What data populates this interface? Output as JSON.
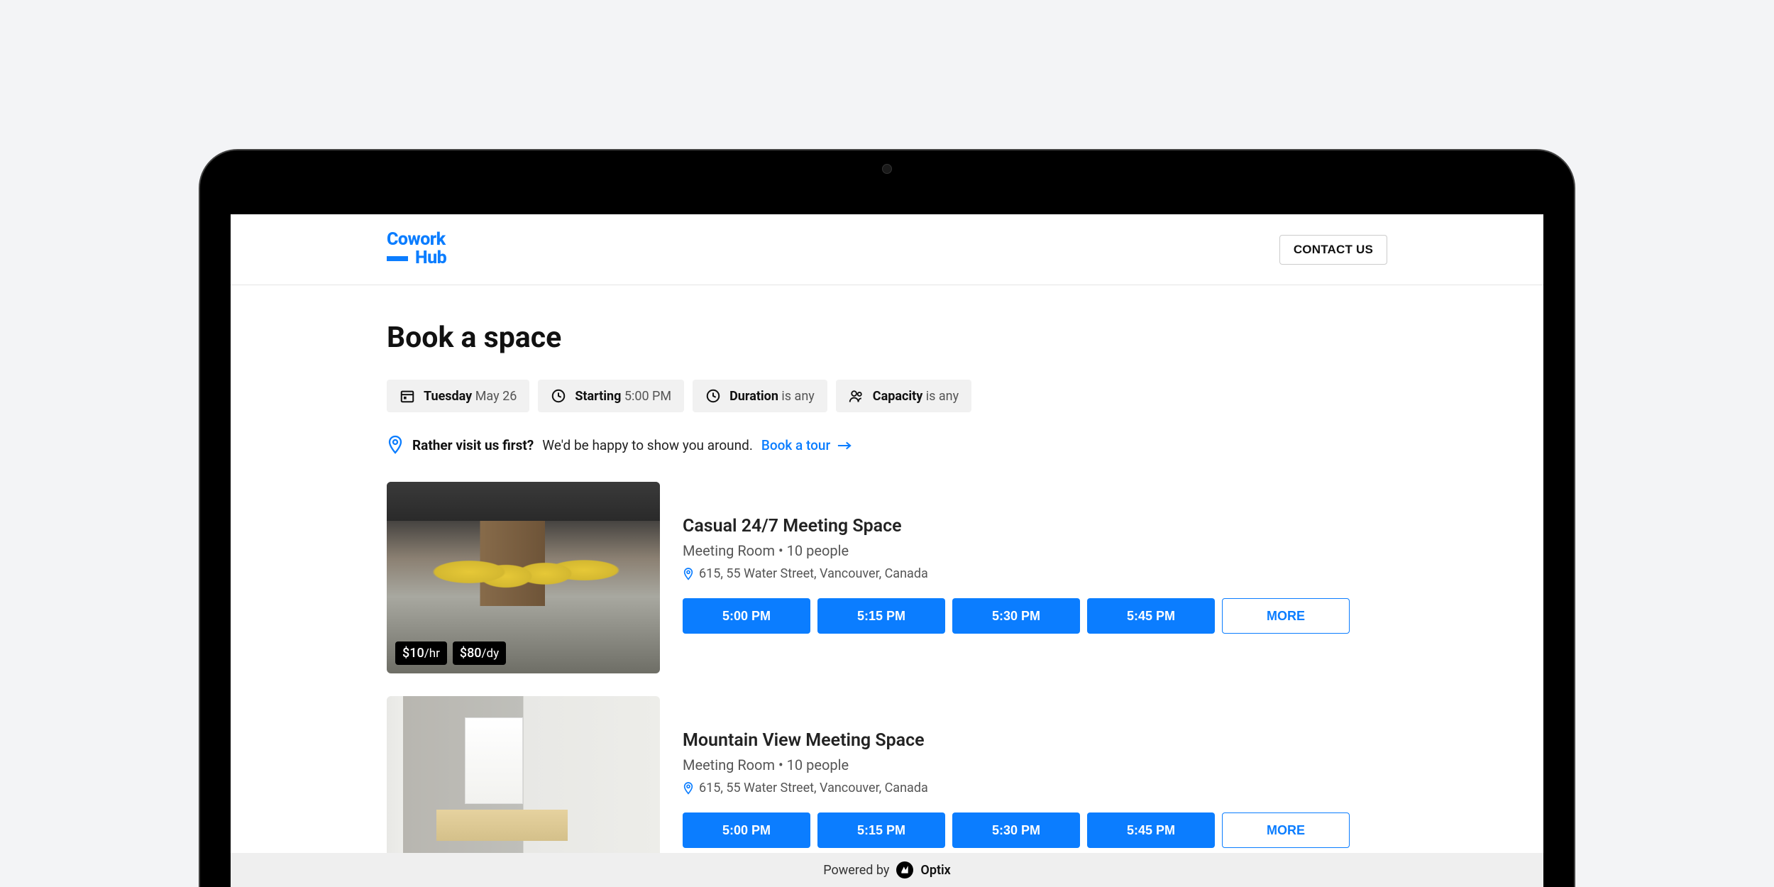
{
  "brand": {
    "line1": "Cowork",
    "line2": "Hub"
  },
  "nav": {
    "contact": "CONTACT US"
  },
  "page": {
    "title": "Book a space"
  },
  "filters": {
    "date": {
      "label": "Tuesday",
      "value": "May 26"
    },
    "start": {
      "label": "Starting",
      "value": "5:00 PM"
    },
    "duration": {
      "label": "Duration",
      "value": "is any"
    },
    "capacity": {
      "label": "Capacity",
      "value": "is any"
    }
  },
  "banner": {
    "strong": "Rather visit us first?",
    "text": "We'd be happy to show you around.",
    "cta": "Book a tour"
  },
  "listings": [
    {
      "title": "Casual 24/7 Meeting Space",
      "type": "Meeting Room",
      "capacity": "10 people",
      "address": "615, 55 Water Street, Vancouver, Canada",
      "prices": [
        {
          "amount": "$10",
          "unit": "/hr"
        },
        {
          "amount": "$80",
          "unit": "/dy"
        }
      ],
      "slots": [
        "5:00 PM",
        "5:15 PM",
        "5:30 PM",
        "5:45 PM"
      ],
      "more": "MORE"
    },
    {
      "title": "Mountain View Meeting Space",
      "type": "Meeting Room",
      "capacity": "10 people",
      "address": "615, 55 Water Street, Vancouver, Canada",
      "prices": [],
      "slots": [
        "5:00 PM",
        "5:15 PM",
        "5:30 PM",
        "5:45 PM"
      ],
      "more": "MORE"
    }
  ],
  "footer": {
    "powered": "Powered by",
    "brand": "Optix"
  }
}
